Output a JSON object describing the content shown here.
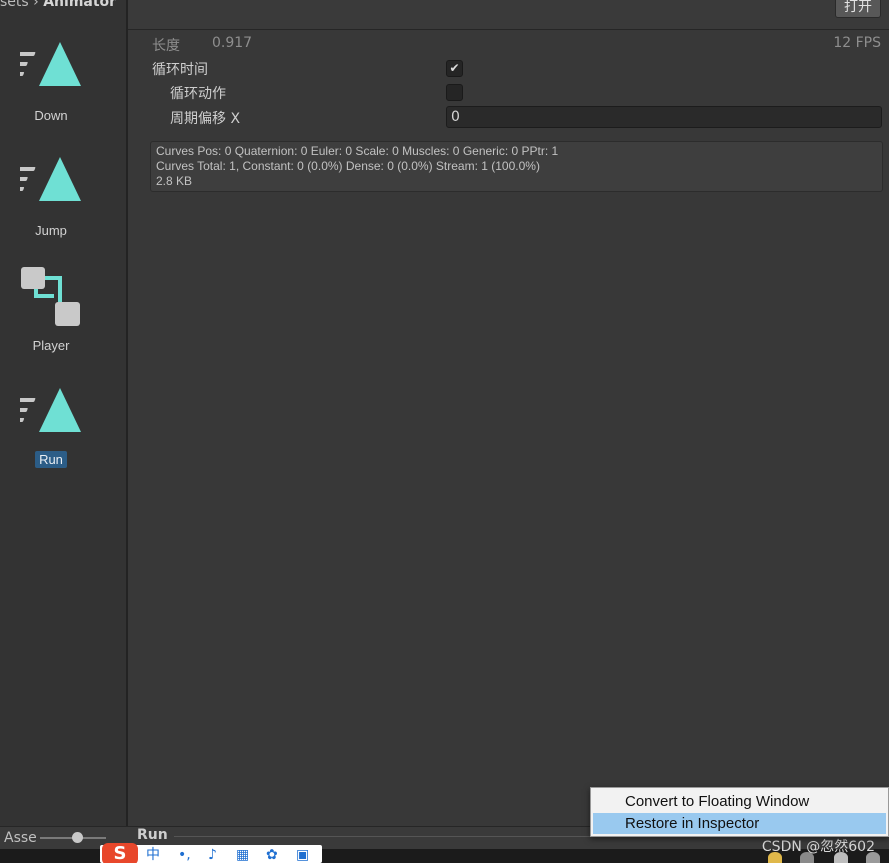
{
  "breadcrumb": {
    "prefix": "sets",
    "separator": "›",
    "current": "Animator"
  },
  "assets": [
    {
      "label": "Down",
      "icon": "animation-clip-icon"
    },
    {
      "label": "Jump",
      "icon": "animation-clip-icon"
    },
    {
      "label": "Player",
      "icon": "animator-controller-icon"
    },
    {
      "label": "Run",
      "icon": "animation-clip-icon",
      "selected": true
    }
  ],
  "toolbar": {
    "open_label": "打开"
  },
  "inspector": {
    "length_label": "长度",
    "length_value": "0.917",
    "fps": "12 FPS",
    "loop_time_label": "循环时间",
    "loop_time_checked": true,
    "loop_pose_label": "循环动作",
    "loop_pose_checked": false,
    "cycle_offset_label": "周期偏移 X",
    "cycle_offset_value": "0"
  },
  "info": {
    "line1": "Curves Pos: 0 Quaternion: 0 Euler: 0 Scale: 0 Muscles: 0 Generic: 0 PPtr: 1",
    "line2": "Curves Total: 1, Constant: 0 (0.0%) Dense: 0 (0.0%) Stream: 1 (100.0%)",
    "line3": "2.8 KB"
  },
  "bottom": {
    "asset_label": "Asse",
    "preview_title": "Run"
  },
  "context_menu": {
    "items": [
      {
        "label": "Convert to Floating Window"
      },
      {
        "label": "Restore in Inspector",
        "highlighted": true
      }
    ]
  },
  "ime": {
    "logo": "S",
    "glyph_zh": "中"
  },
  "watermark": "CSDN @忽然602",
  "colors": {
    "accent": "#6fe0d4",
    "selection": "#2c5d87",
    "menu_highlight": "#99c9ef"
  }
}
